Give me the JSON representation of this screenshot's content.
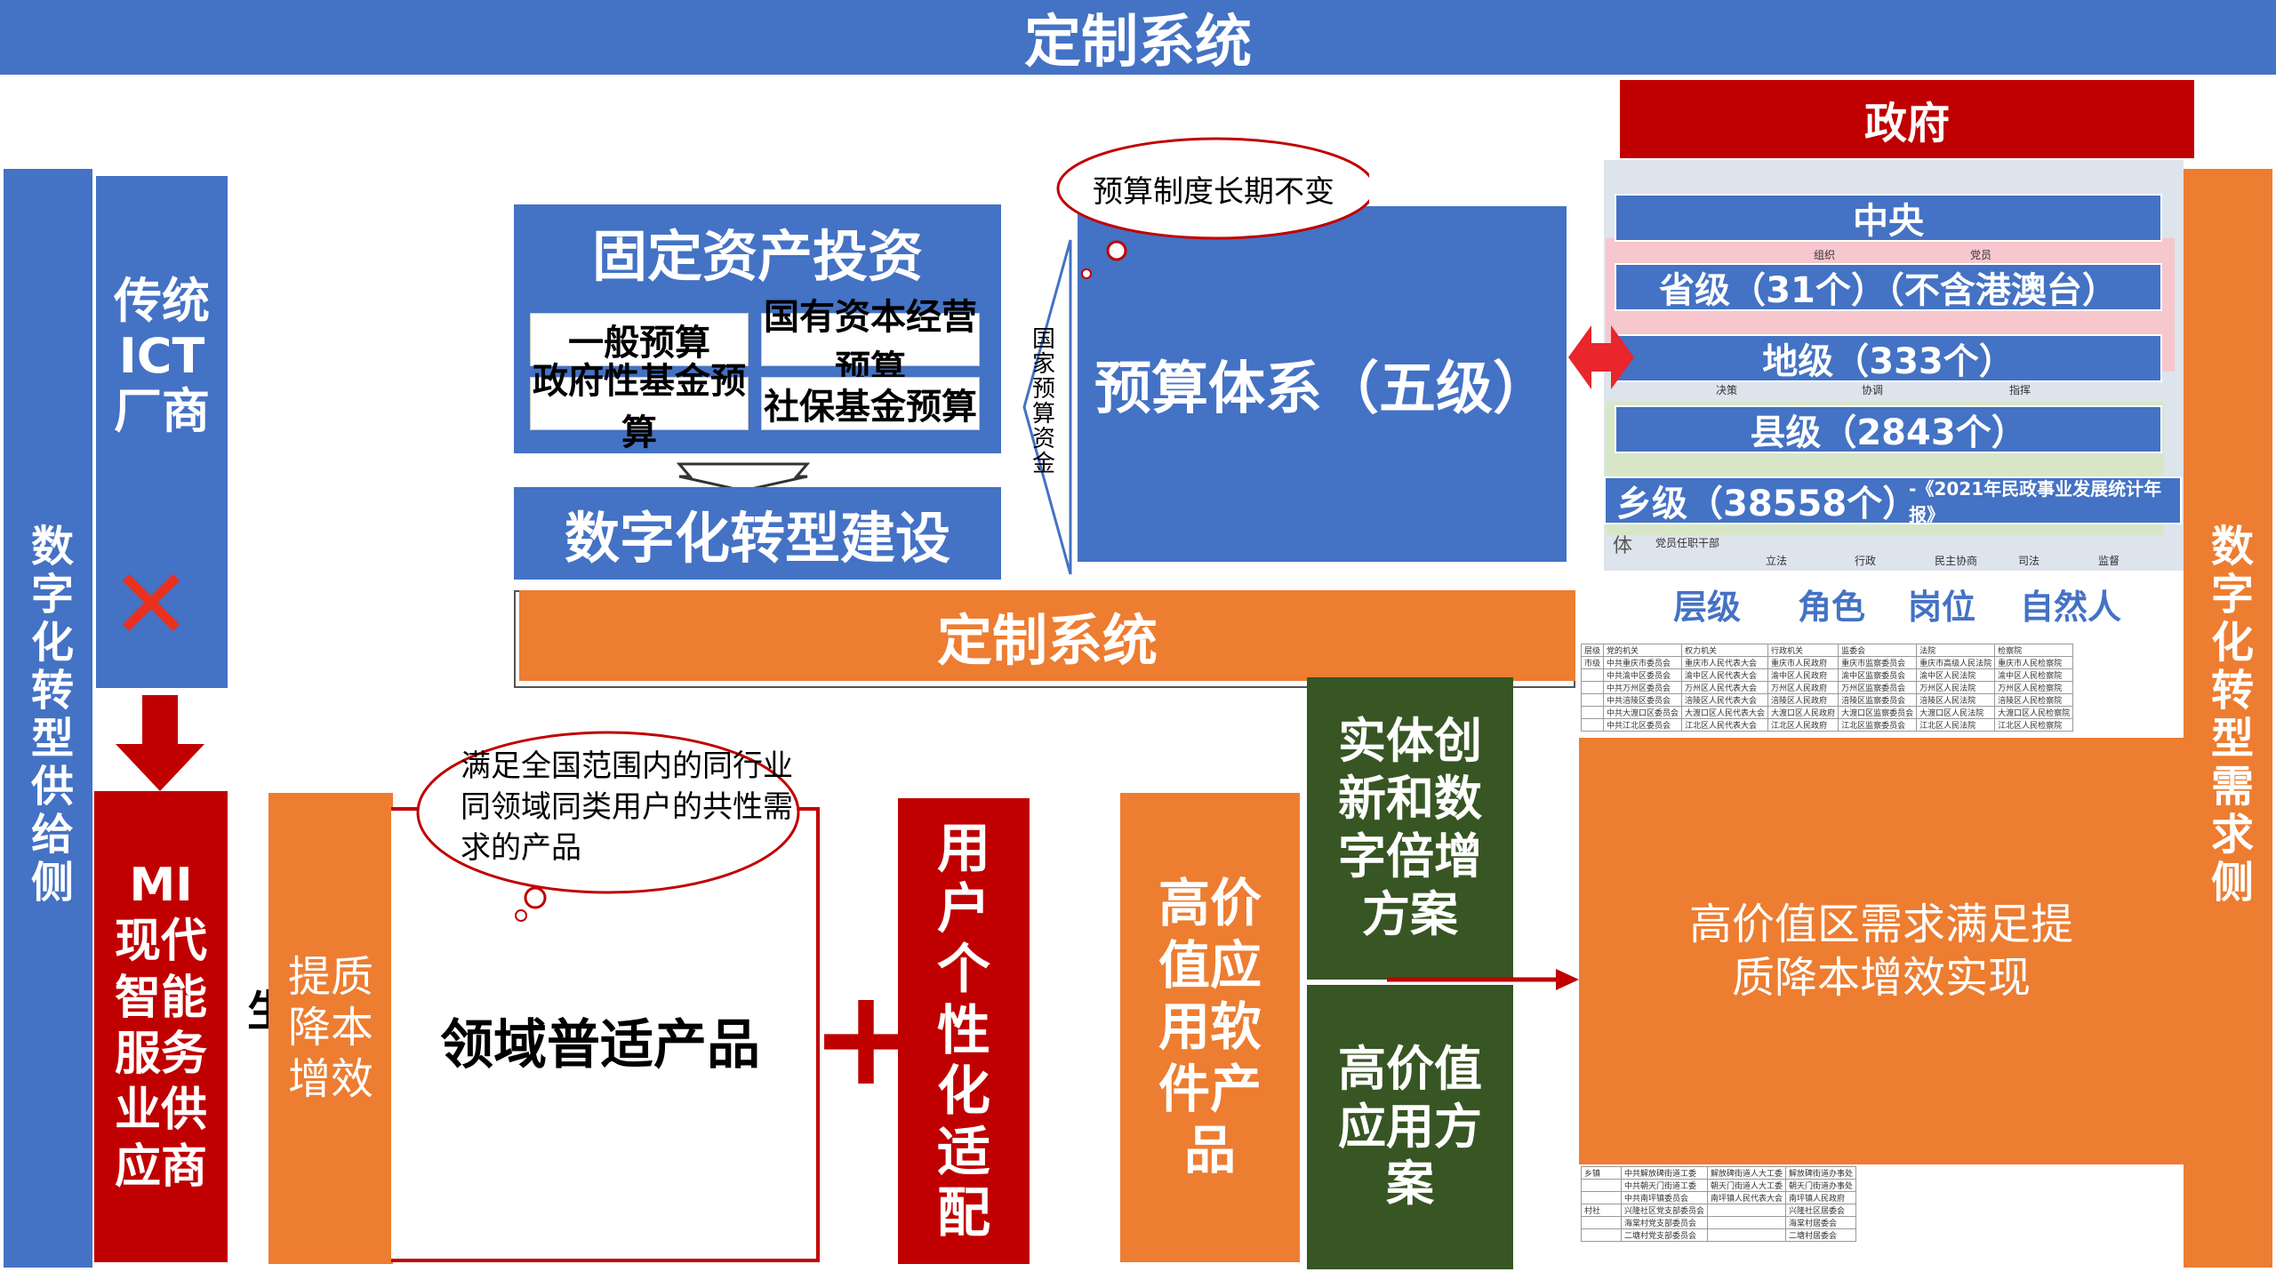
{
  "title": "定制系统",
  "supply_side": "数字化转型供给侧",
  "demand_side": "数字化转型需求侧",
  "traditional_vendor": "传统ICT厂商",
  "mi_vendor": "MI现代智能服务业供应商",
  "cross_mark": "✕",
  "budget": {
    "fixed_asset_title": "固定资产投资",
    "items": [
      "一般预算",
      "国有资本经营预算",
      "政府性基金预算",
      "社保基金预算"
    ],
    "transform_title": "数字化转型建设",
    "national_funds": "国家预算资金",
    "system_title": "预算体系（五级）",
    "cloud": "预算制度长期不变"
  },
  "custom_system_bar": "定制系统",
  "government": {
    "header": "政府",
    "levels": [
      "中央",
      "省级（31个）（不含港澳台）",
      "地级（333个）",
      "县级（2843个）",
      "乡级（38558个）"
    ],
    "source_note": "-《2021年民政事业发展统计年报》",
    "categories": [
      "层级",
      "角色",
      "岗位",
      "自然人"
    ],
    "bg_labels": [
      "组织",
      "党员",
      "决策",
      "协调",
      "指挥",
      "立法",
      "行政",
      "民主协商",
      "司法",
      "监督",
      "党员任职干部",
      "体"
    ]
  },
  "table_bg": {
    "top_headers": [
      "层级",
      "党的机关",
      "权力机关",
      "行政机关",
      "监委会",
      "法院",
      "检察院"
    ],
    "top_row_label": "市级",
    "top_rows": [
      [
        "中共重庆市委员会",
        "重庆市人民代表大会",
        "重庆市人民政府",
        "重庆市监察委员会",
        "重庆市高级人民法院",
        "重庆市人民检察院"
      ],
      [
        "中共渝中区委员会",
        "渝中区人民代表大会",
        "渝中区人民政府",
        "渝中区监察委员会",
        "渝中区人民法院",
        "渝中区人民检察院"
      ],
      [
        "中共万州区委员会",
        "万州区人民代表大会",
        "万州区人民政府",
        "万州区监察委员会",
        "万州区人民法院",
        "万州区人民检察院"
      ],
      [
        "中共涪陵区委员会",
        "涪陵区人民代表大会",
        "涪陵区人民政府",
        "涪陵区监察委员会",
        "涪陵区人民法院",
        "涪陵区人民检察院"
      ],
      [
        "中共大渡口区委员会",
        "大渡口区人民代表大会",
        "大渡口区人民政府",
        "大渡口区监察委员会",
        "大渡口区人民法院",
        "大渡口区人民检察院"
      ],
      [
        "中共江北区委员会",
        "江北区人民代表大会",
        "江北区人民政府",
        "江北区监察委员会",
        "江北区人民法院",
        "江北区人民检察院"
      ]
    ],
    "bottom_labels": [
      "乡镇",
      "村社"
    ],
    "bottom_rows": [
      [
        "中共解放碑街道工委",
        "解放碑街道人大工委",
        "解放碑街道办事处"
      ],
      [
        "中共朝天门街道工委",
        "朝天门街道人大工委",
        "朝天门街道办事处"
      ],
      [
        "中共南坪镇委员会",
        "南坪镇人民代表大会",
        "南坪镇人民政府"
      ],
      [
        "兴隆社区党支部委员会",
        "",
        "兴隆社区居委会"
      ],
      [
        "海棠村党支部委员会",
        "",
        "海棠村居委会"
      ],
      [
        "二塘村党支部委员会",
        "",
        "二塘村居委会"
      ]
    ]
  },
  "bottom": {
    "quality_label": "提质降本增效",
    "product_label": "领域普适产品",
    "product_cloud": "满足全国范围内的同行业同领域同类用户的共性需求的产品",
    "plus": "+",
    "user_adapt": "用户个性化适配",
    "high_value_software": "高价值应用软件产品",
    "entity_innovation": "实体创新和数字倍增方案",
    "high_value_solution": "高价值应用方案",
    "demand_result": "高价值区需求满足提质降本增效实现",
    "partial_char": "生"
  }
}
